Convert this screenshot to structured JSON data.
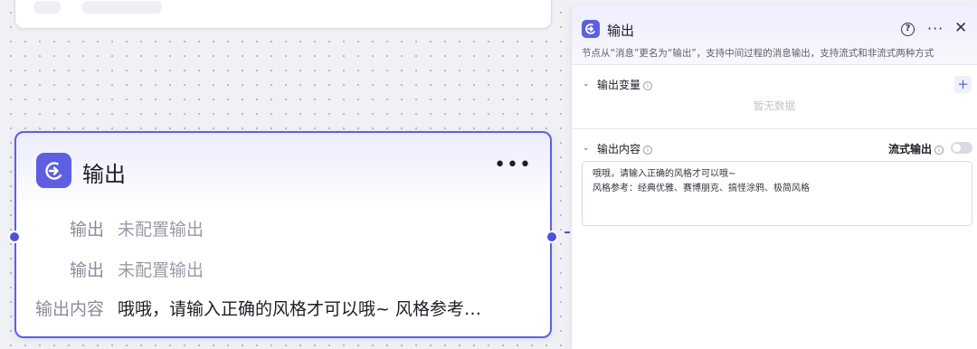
{
  "node": {
    "title": "输出",
    "more_label": "•••",
    "rows": [
      {
        "label": "输出",
        "value": "未配置输出"
      },
      {
        "label": "输出",
        "value": "未配置输出"
      },
      {
        "label": "输出内容",
        "value": "哦哦，请输入正确的风格才可以哦~ 风格参考…"
      }
    ]
  },
  "panel": {
    "title": "输出",
    "description": "节点从“消息”更名为“输出”，支持中间过程的消息输出，支持流式和非流式两种方式",
    "help_label": "?",
    "more_label": "···",
    "close_label": "✕",
    "output_variables": {
      "title": "输出变量",
      "add_label": "+",
      "empty_text": "暂无数据"
    },
    "output_content": {
      "title": "输出内容",
      "stream_label": "流式输出",
      "stream_enabled": false,
      "lines": [
        "哦哦，请输入正确的风格才可以哦~",
        "风格参考：经典优雅、赛博朋克、搞怪涂鸦、极简风格"
      ]
    }
  },
  "icons": [
    "arrow-right-circle-icon",
    "help-icon",
    "more-icon",
    "close-icon",
    "chevron-down-icon",
    "info-icon",
    "plus-icon"
  ],
  "colors": {
    "accent": "#5d5fe0",
    "border_selected": "#5d5fe0",
    "canvas": "#f0f1f5"
  }
}
